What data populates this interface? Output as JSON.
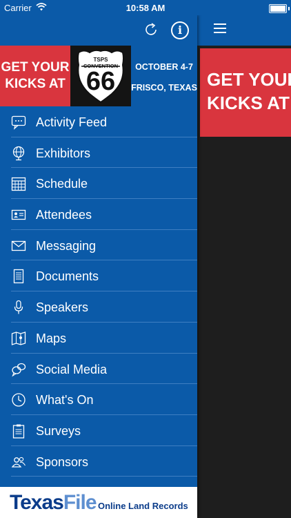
{
  "status_bar": {
    "carrier": "Carrier",
    "time": "10:58 AM"
  },
  "drawer": {
    "banner": {
      "left_line1": "GET YOUR",
      "left_line2": "KICKS AT",
      "shield_top": "TSPS",
      "shield_mid": "CONVENTION",
      "shield_number": "66",
      "date_line": "OCTOBER 4-7",
      "location_line": "FRISCO, TEXAS"
    },
    "menu": [
      {
        "label": "Activity Feed",
        "icon": "chat-bubble-icon"
      },
      {
        "label": "Exhibitors",
        "icon": "globe-icon"
      },
      {
        "label": "Schedule",
        "icon": "calendar-icon"
      },
      {
        "label": "Attendees",
        "icon": "id-card-icon"
      },
      {
        "label": "Messaging",
        "icon": "envelope-icon"
      },
      {
        "label": "Documents",
        "icon": "document-icon"
      },
      {
        "label": "Speakers",
        "icon": "microphone-icon"
      },
      {
        "label": "Maps",
        "icon": "map-icon"
      },
      {
        "label": "Social Media",
        "icon": "social-bubbles-icon"
      },
      {
        "label": "What's On",
        "icon": "clock-icon"
      },
      {
        "label": "Surveys",
        "icon": "clipboard-icon"
      },
      {
        "label": "Sponsors",
        "icon": "people-icon"
      }
    ],
    "footer": {
      "logo_part1": "Texas",
      "logo_part2": "File",
      "tagline": "Online Land Records"
    }
  },
  "main": {
    "banner_line1": "GET YOUR",
    "banner_line2": "KICKS AT"
  },
  "colors": {
    "primary": "#0b5aa8",
    "accent_red": "#d9353e",
    "dark": "#1e1e1e"
  }
}
